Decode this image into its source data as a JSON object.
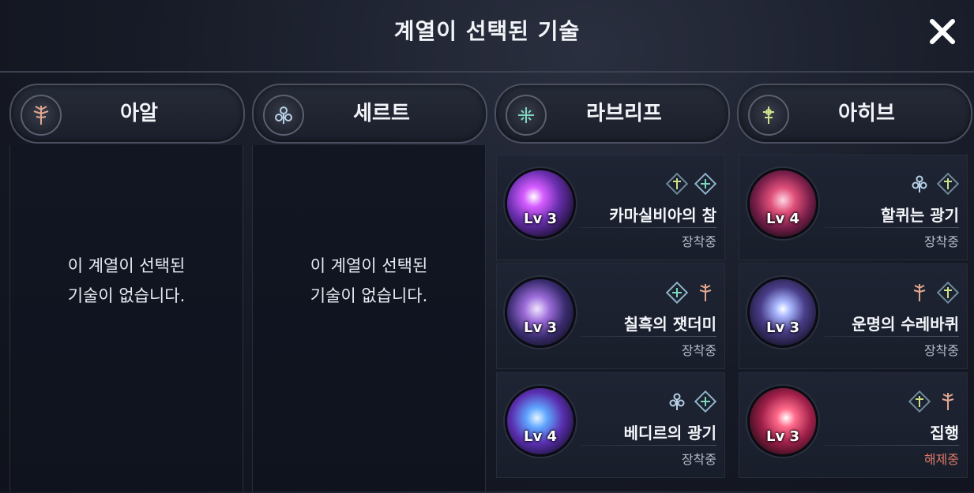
{
  "title": "계열이 선택된 기술",
  "close_icon": "close-x-icon",
  "columns": [
    {
      "name": "아알",
      "emblem_icon": "aal-emblem-icon",
      "empty_line1": "이 계열이 선택된",
      "empty_line2": "기술이 없습니다."
    },
    {
      "name": "세르트",
      "emblem_icon": "sert-emblem-icon",
      "empty_line1": "이 계열이 선택된",
      "empty_line2": "기술이 없습니다."
    },
    {
      "name": "라브리프",
      "emblem_icon": "labrif-emblem-icon",
      "skills": [
        {
          "name": "카마실비아의 참",
          "level": "Lv 3",
          "status": "장착중",
          "badges": [
            "ahib-badge-icon",
            "labrif-badge-icon"
          ]
        },
        {
          "name": "칠흑의 잿더미",
          "level": "Lv 3",
          "status": "장착중",
          "badges": [
            "labrif-badge-icon",
            "aal-badge-icon"
          ]
        },
        {
          "name": "베디르의 광기",
          "level": "Lv 4",
          "status": "장착중",
          "badges": [
            "sert-badge-icon",
            "labrif-badge-icon"
          ]
        }
      ]
    },
    {
      "name": "아히브",
      "emblem_icon": "ahib-emblem-icon",
      "skills": [
        {
          "name": "할퀴는 광기",
          "level": "Lv 4",
          "status": "장착중",
          "badges": [
            "sert-badge-icon",
            "ahib-badge-icon"
          ]
        },
        {
          "name": "운명의 수레바퀴",
          "level": "Lv 3",
          "status": "장착중",
          "badges": [
            "aal-badge-icon",
            "ahib-badge-icon"
          ]
        },
        {
          "name": "집행",
          "level": "Lv 3",
          "status": "해제중",
          "badges": [
            "ahib-badge-icon",
            "aal-badge-icon"
          ]
        }
      ]
    }
  ],
  "colors": {
    "status_equipped": "#b5bccb",
    "status_unequipped": "#e07a6a"
  }
}
